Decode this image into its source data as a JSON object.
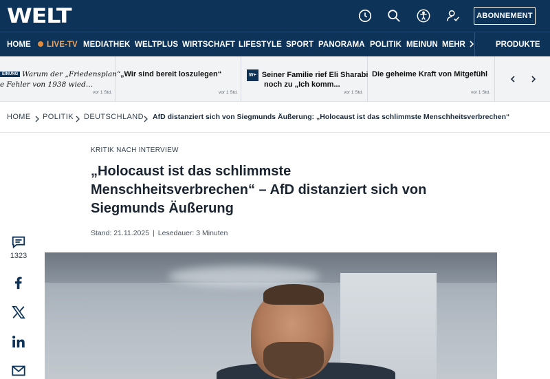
{
  "header": {
    "logo": "WELT",
    "icons": [
      "clock-icon",
      "search-icon",
      "accessibility-icon",
      "user-check-icon"
    ],
    "subscribe_label": "ABONNEMENT",
    "colors": {
      "brand": "#0d3358",
      "live": "#f0a45a"
    }
  },
  "nav": {
    "items": [
      {
        "label": "HOME"
      },
      {
        "label": "LIVE-TV",
        "live": true
      },
      {
        "label": "MEDIATHEK"
      },
      {
        "label": "WELTPLUS"
      },
      {
        "label": "WIRTSCHAFT"
      },
      {
        "label": "LIFESTYLE"
      },
      {
        "label": "SPORT"
      },
      {
        "label": "PANORAMA"
      },
      {
        "label": "POLITIK"
      },
      {
        "label": "MEINUN"
      }
    ],
    "more_label": "MEHR",
    "products_label": "PRODUKTE"
  },
  "teasers": [
    {
      "badge": "EINUNG",
      "line1": "Warum der „Friedensplan“",
      "line2": "e Fehler von 1938 wied...",
      "time": "vor 1 Std."
    },
    {
      "line1": "„Wir sind bereit loszulegen“",
      "line2": "",
      "time": "vor 1 Std."
    },
    {
      "badge": "W+",
      "line1": "Seiner Familie rief Eli Sharabi",
      "line2": "noch zu „Ich komm...",
      "time": "vor 1 Std."
    },
    {
      "line1": "Die geheime Kraft von Mitgefühl",
      "line2": "",
      "time": "vor 1 Std."
    }
  ],
  "breadcrumb": {
    "items": [
      "HOME",
      "POLITIK",
      "DEUTSCHLAND"
    ],
    "current": "AfD distanziert sich von Siegmunds Äußerung: „Holocaust ist das schlimmste Menschheitsverbrechen“"
  },
  "article": {
    "kicker": "KRITIK NACH INTERVIEW",
    "headline_line1": "„Holocaust ist das schlimmste",
    "headline_line2": "Menschheitsverbrechen“ – AfD distanziert sich von",
    "headline_line3": "Siegmunds Äußerung",
    "date": "Stand: 21.11.2025",
    "reading_time": "Lesedauer: 3 Minuten",
    "meta_separator": "|"
  },
  "share": {
    "comment_count": "1323",
    "icons": [
      "comment-icon",
      "facebook-icon",
      "x-icon",
      "linkedin-icon",
      "mail-icon"
    ]
  }
}
